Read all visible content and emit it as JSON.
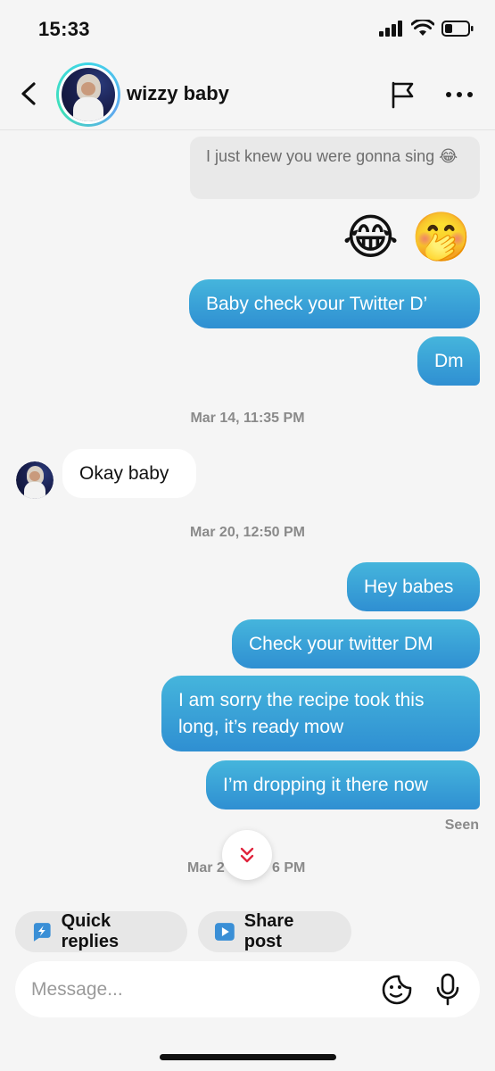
{
  "status_bar": {
    "time": "15:33"
  },
  "header": {
    "contact_name": "wizzy baby"
  },
  "messages": {
    "quoted_text": "I just knew you were gonna sing 😂",
    "emoji_1": "😂",
    "emoji_2": "🤭",
    "m1": "Baby check your Twitter D’",
    "m2": "Dm",
    "ts1": "Mar 14, 11:35 PM",
    "in1": "Okay baby",
    "ts2": "Mar 20, 12:50 PM",
    "m3": "Hey babes",
    "m4": "Check your twitter DM",
    "m5": "I am sorry the recipe took this long, it’s ready mow",
    "m6": "I’m dropping it there now",
    "seen": "Seen",
    "ts3_left": "Mar 2",
    "ts3_right": "6 PM"
  },
  "actions": {
    "quick_replies": "Quick replies",
    "share_post": "Share post"
  },
  "composer": {
    "placeholder": "Message..."
  },
  "colors": {
    "outgoing_bubble": "#3a9fd7",
    "scroll_chevron": "#e0243d",
    "quick_reply_icon": "#3a8fd6"
  }
}
